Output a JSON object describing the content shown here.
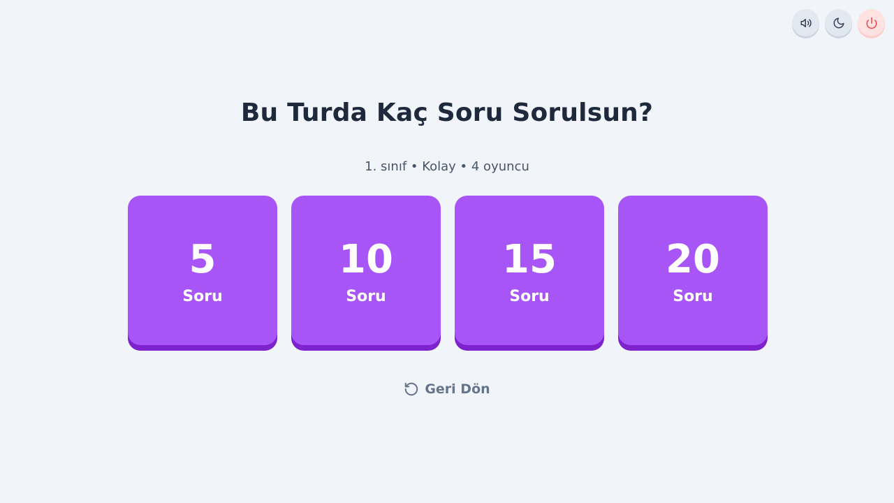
{
  "controls": {
    "sound_icon": "volume-icon",
    "theme_icon": "moon-icon",
    "power_icon": "power-icon"
  },
  "title": "Bu Turda Kaç Soru Sorulsun?",
  "subtitle": "1. sınıf • Kolay • 4 oyuncu",
  "options": [
    {
      "count": "5",
      "label": "Soru"
    },
    {
      "count": "10",
      "label": "Soru"
    },
    {
      "count": "15",
      "label": "Soru"
    },
    {
      "count": "20",
      "label": "Soru"
    }
  ],
  "back_label": "Geri Dön",
  "colors": {
    "card": "#a855f7",
    "card_shadow": "#7e22ce",
    "background": "#f1f5f9",
    "title": "#1e293b"
  }
}
